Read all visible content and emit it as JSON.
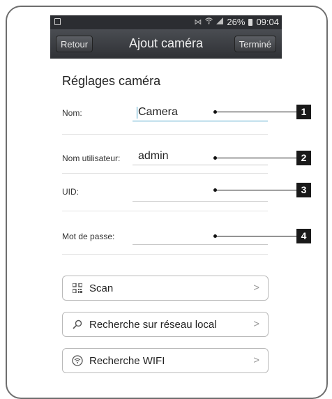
{
  "status_bar": {
    "battery_pct": "26%",
    "time": "09:04",
    "icons": [
      "screen-icon",
      "nfc-icon",
      "wifi-icon",
      "signal-icon",
      "battery-icon"
    ]
  },
  "navbar": {
    "back_label": "Retour",
    "title": "Ajout caméra",
    "done_label": "Terminé"
  },
  "form": {
    "section_title": "Réglages caméra",
    "fields": [
      {
        "label": "Nom:",
        "value": "Camera"
      },
      {
        "label": "Nom utilisateur:",
        "value": "admin"
      },
      {
        "label": "UID:",
        "value": ""
      },
      {
        "label": "Mot de passe:",
        "value": ""
      }
    ]
  },
  "actions": [
    {
      "label": "Scan",
      "icon": "qr-code-icon"
    },
    {
      "label": "Recherche sur réseau local",
      "icon": "search-icon"
    },
    {
      "label": "Recherche WIFI",
      "icon": "wifi-icon"
    }
  ],
  "callouts": [
    "1",
    "2",
    "3",
    "4"
  ],
  "colors": {
    "navbar": "#3a3c40",
    "status_bar": "#2b2d31",
    "input_focus": "#4ba3c9",
    "callout_bg": "#1a1a1a"
  }
}
